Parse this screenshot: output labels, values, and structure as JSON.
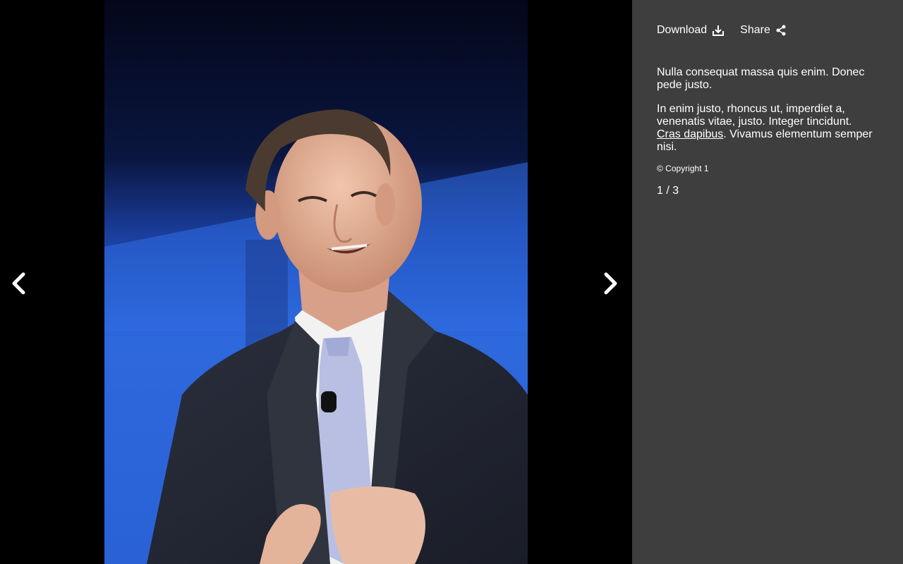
{
  "toolbar": {
    "download_label": "Download",
    "share_label": "Share",
    "download_icon": "download-icon",
    "share_icon": "share-icon"
  },
  "caption": {
    "paragraph1": "Nulla consequat massa quis enim. Donec pede justo.",
    "paragraph2_before": "In enim justo, rhoncus ut, imperdiet a, venenatis vitae, justo. Integer tincidunt.",
    "paragraph2_link": "Cras dapibus",
    "paragraph2_after": ". Vivamus elementum semper nisi.",
    "copyright": "© Copyright 1"
  },
  "counter": "1 / 3",
  "nav": {
    "prev_icon": "chevron-left-icon",
    "next_icon": "chevron-right-icon"
  },
  "colors": {
    "viewer_bg": "#000000",
    "sidebar_bg": "#3e3e3e",
    "text": "#ffffff",
    "photo_backdrop_blue": "#2f6ae0"
  }
}
